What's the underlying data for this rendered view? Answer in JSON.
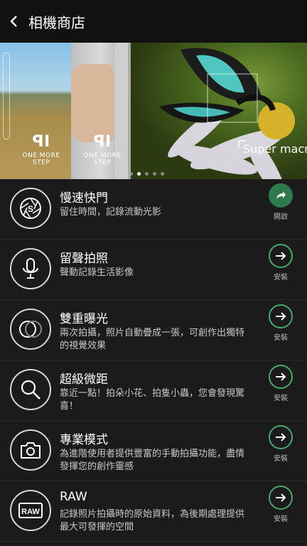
{
  "header": {
    "title": "相機商店",
    "back_icon": "back-arrow-icon"
  },
  "banner": {
    "slide1_brand": "ONE MORE STEP",
    "slide2_brand": "ONE MORE STEP",
    "slide3_caption": "Super macr",
    "dots_count": 5,
    "active_dot": 1
  },
  "items": [
    {
      "name": "慢速快門",
      "desc": "留住時間，記錄流動光影",
      "action": "開啟",
      "icon": "aperture-icon",
      "action_icon": "share-arrow-icon"
    },
    {
      "name": "留聲拍照",
      "desc": "聲動記錄生活影像",
      "action": "安裝",
      "icon": "microphone-icon",
      "action_icon": "arrow-right-icon"
    },
    {
      "name": "雙重曝光",
      "desc": "兩次拍攝，照片自動疊成一張，可創作出獨特的視覺效果",
      "action": "安裝",
      "icon": "double-circle-icon",
      "action_icon": "arrow-right-icon"
    },
    {
      "name": "超級微距",
      "desc": "靠近一點！拍朵小花、拍隻小蟲，您會發現驚喜！",
      "action": "安裝",
      "icon": "magnifier-icon",
      "action_icon": "arrow-right-icon"
    },
    {
      "name": "專業模式",
      "desc": "為進階使用者提供豐富的手動拍攝功能，盡情發揮您的創作靈感",
      "action": "安裝",
      "icon": "camera-icon",
      "action_icon": "arrow-right-icon"
    },
    {
      "name": "RAW",
      "desc": "記錄照片拍攝時的原始資料，為後期處理提供最大可發揮的空間",
      "action": "安裝",
      "icon": "raw-icon",
      "action_icon": "arrow-right-icon"
    }
  ],
  "colors": {
    "accent": "#49a86c",
    "background": "#1b1b1b"
  }
}
